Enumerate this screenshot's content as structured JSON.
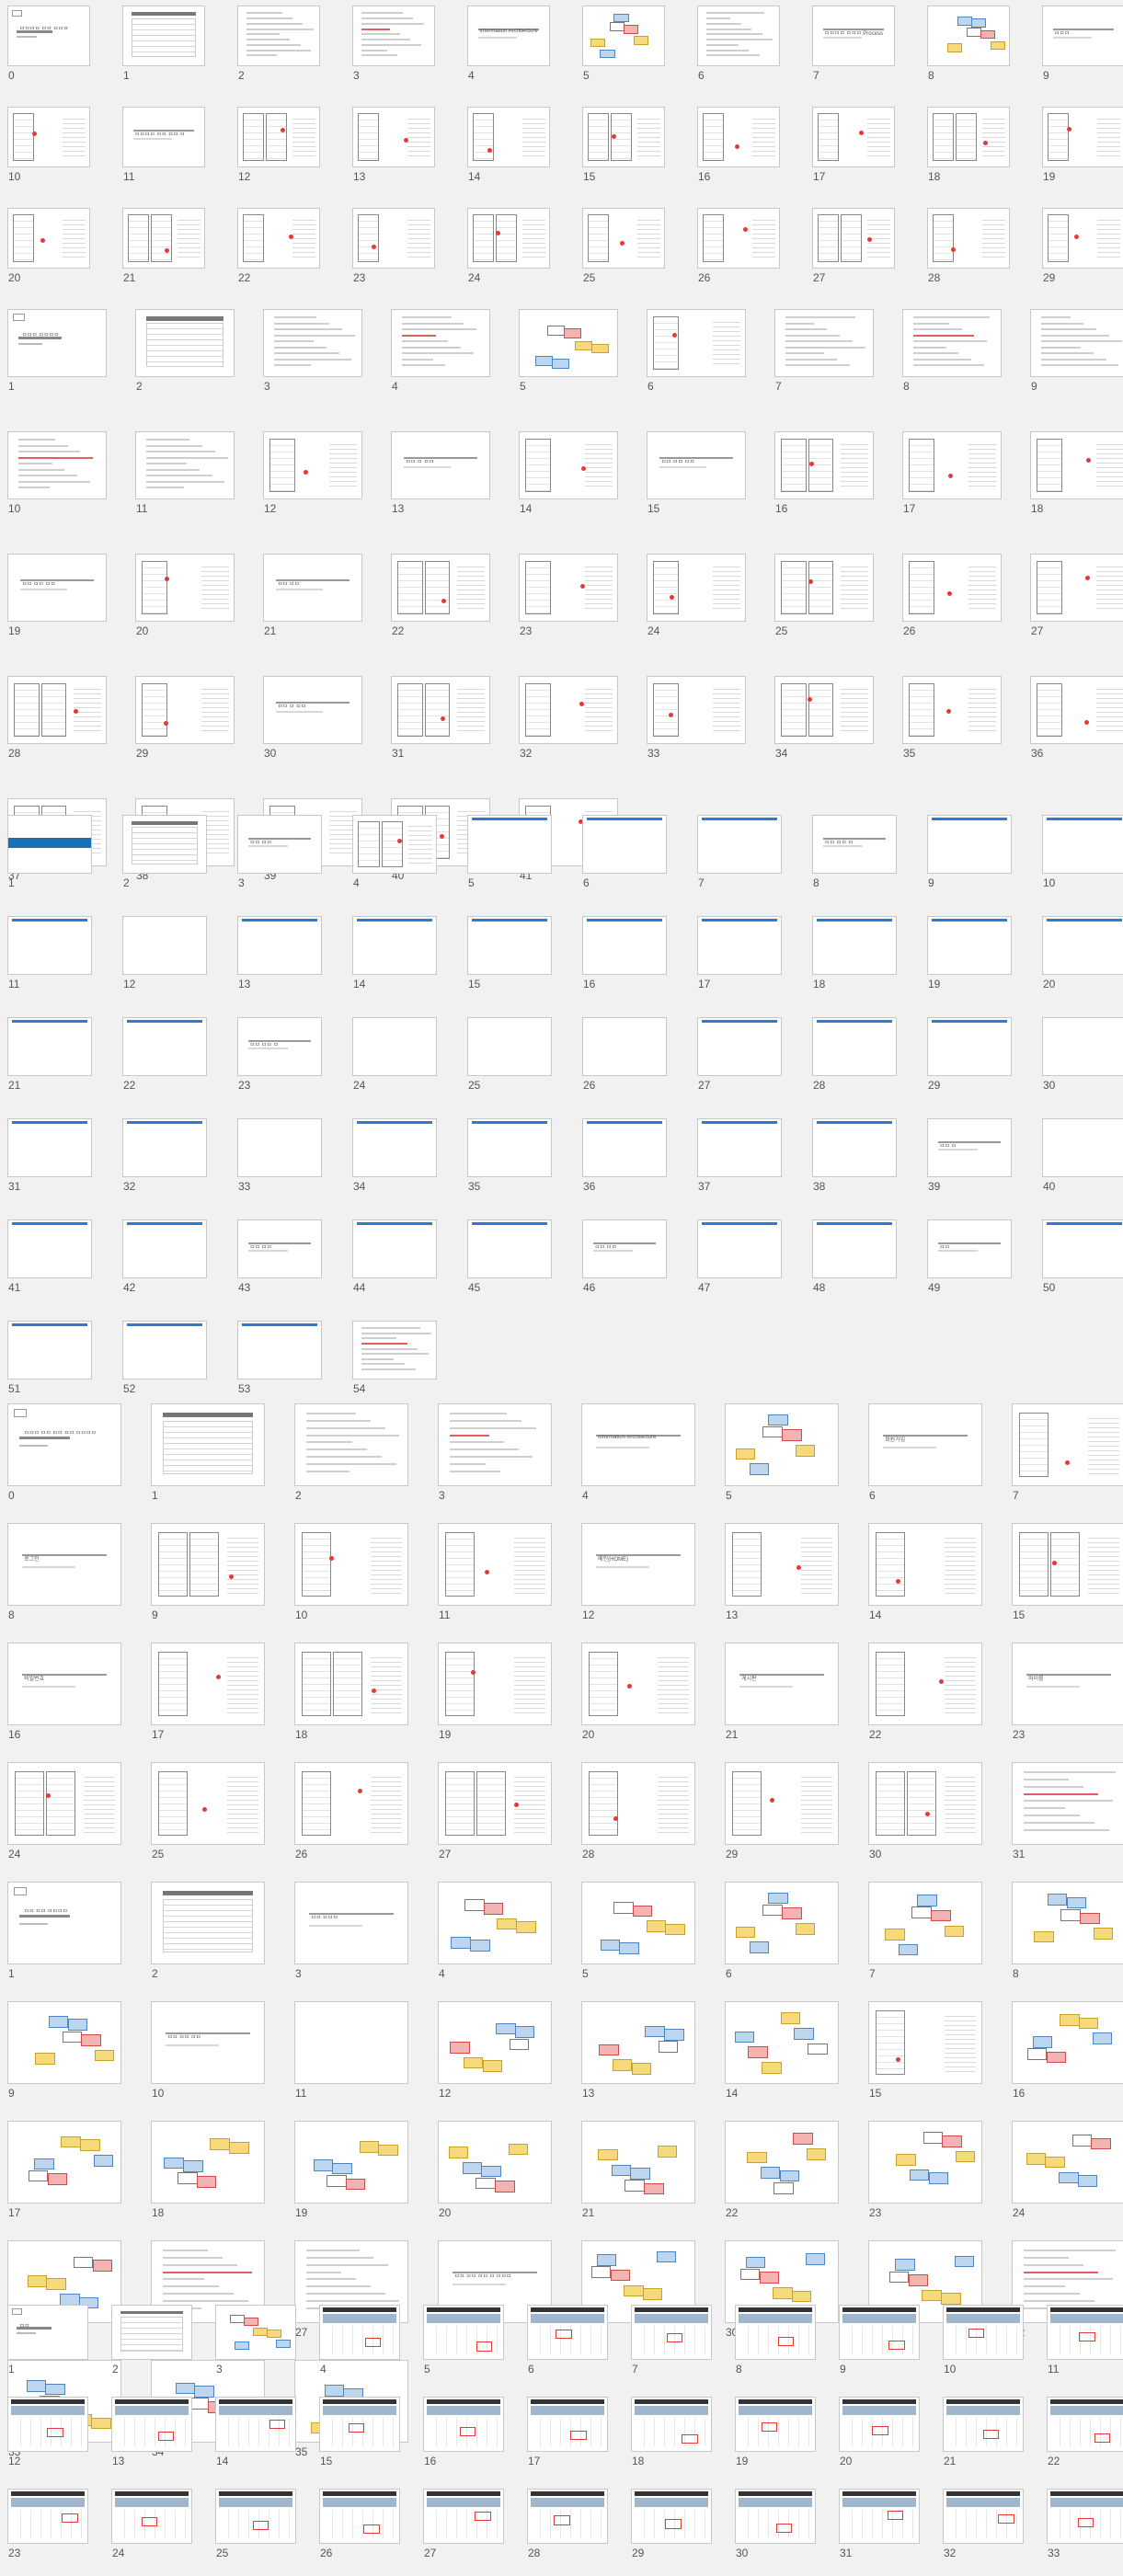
{
  "sections": [
    {
      "id": "deck1",
      "slides": [
        {
          "n": "0",
          "k": "title",
          "label": "ㅁㅁㅁㅁ ㅁㅁ ㅁㅁㅁ"
        },
        {
          "n": "1",
          "k": "table"
        },
        {
          "n": "2",
          "k": "doc"
        },
        {
          "n": "3",
          "k": "doc"
        },
        {
          "n": "4",
          "k": "text",
          "label": "Information Architecture"
        },
        {
          "n": "5",
          "k": "flow"
        },
        {
          "n": "6",
          "k": "doc"
        },
        {
          "n": "7",
          "k": "text",
          "label": "ㅁㅁㅁㅁ ㅁㅁㅁ Process"
        },
        {
          "n": "8",
          "k": "flow"
        },
        {
          "n": "9",
          "k": "text",
          "label": "ㅁㅁㅁ"
        },
        {
          "n": "10",
          "k": "wire"
        },
        {
          "n": "11",
          "k": "text",
          "label": "ㅁㅁㅁㅁ ㅁㅁ ㅁㅁ ㅁ"
        },
        {
          "n": "12",
          "k": "wire"
        },
        {
          "n": "13",
          "k": "wire"
        },
        {
          "n": "14",
          "k": "wire"
        },
        {
          "n": "15",
          "k": "wire"
        },
        {
          "n": "16",
          "k": "wire"
        },
        {
          "n": "17",
          "k": "wire"
        },
        {
          "n": "18",
          "k": "wire"
        },
        {
          "n": "19",
          "k": "wire"
        },
        {
          "n": "20",
          "k": "wire"
        },
        {
          "n": "21",
          "k": "wire"
        },
        {
          "n": "22",
          "k": "wire"
        },
        {
          "n": "23",
          "k": "wire"
        },
        {
          "n": "24",
          "k": "wire"
        },
        {
          "n": "25",
          "k": "wire"
        },
        {
          "n": "26",
          "k": "wire"
        },
        {
          "n": "27",
          "k": "wire"
        },
        {
          "n": "28",
          "k": "wire"
        },
        {
          "n": "29",
          "k": "wire"
        }
      ]
    },
    {
      "id": "deck2",
      "slides": [
        {
          "n": "1",
          "k": "title",
          "label": "ㅁㅁㅁ ㅁㅁㅁㅁ"
        },
        {
          "n": "2",
          "k": "table"
        },
        {
          "n": "3",
          "k": "doc"
        },
        {
          "n": "4",
          "k": "doc"
        },
        {
          "n": "5",
          "k": "flow"
        },
        {
          "n": "6",
          "k": "wire"
        },
        {
          "n": "7",
          "k": "doc"
        },
        {
          "n": "8",
          "k": "doc"
        },
        {
          "n": "9",
          "k": "doc"
        },
        {
          "n": "10",
          "k": "doc"
        },
        {
          "n": "11",
          "k": "doc"
        },
        {
          "n": "12",
          "k": "wire"
        },
        {
          "n": "13",
          "k": "text",
          "label": "ㅁㅁ ㅁ ㅁㅁ"
        },
        {
          "n": "14",
          "k": "wire"
        },
        {
          "n": "15",
          "k": "text",
          "label": "ㅁㅁ ㅁㅁ ㅁㅁ"
        },
        {
          "n": "16",
          "k": "wire"
        },
        {
          "n": "17",
          "k": "wire"
        },
        {
          "n": "18",
          "k": "wire"
        },
        {
          "n": "19",
          "k": "text",
          "label": "ㅁㅁ ㅁㅁ ㅁㅁ"
        },
        {
          "n": "20",
          "k": "wire"
        },
        {
          "n": "21",
          "k": "text",
          "label": "ㅁㅁ ㅁㅁ"
        },
        {
          "n": "22",
          "k": "wire"
        },
        {
          "n": "23",
          "k": "wire"
        },
        {
          "n": "24",
          "k": "wire"
        },
        {
          "n": "25",
          "k": "wire"
        },
        {
          "n": "26",
          "k": "wire"
        },
        {
          "n": "27",
          "k": "wire"
        },
        {
          "n": "28",
          "k": "wire"
        },
        {
          "n": "29",
          "k": "wire"
        },
        {
          "n": "30",
          "k": "text",
          "label": "ㅁㅁ ㅁ ㅁㅁ"
        },
        {
          "n": "31",
          "k": "wire"
        },
        {
          "n": "32",
          "k": "wire"
        },
        {
          "n": "33",
          "k": "wire"
        },
        {
          "n": "34",
          "k": "wire"
        },
        {
          "n": "35",
          "k": "wire"
        },
        {
          "n": "36",
          "k": "wire"
        },
        {
          "n": "37",
          "k": "wire"
        },
        {
          "n": "38",
          "k": "wire"
        },
        {
          "n": "39",
          "k": "wire"
        },
        {
          "n": "40",
          "k": "wire"
        },
        {
          "n": "41",
          "k": "wire"
        }
      ]
    },
    {
      "id": "deck3",
      "slides": [
        {
          "n": "1",
          "k": "cover"
        },
        {
          "n": "2",
          "k": "table"
        },
        {
          "n": "3",
          "k": "text",
          "label": "ㅁㅁ ㅁㅁ"
        },
        {
          "n": "4",
          "k": "wire"
        },
        {
          "n": "5",
          "k": "blue"
        },
        {
          "n": "6",
          "k": "blue"
        },
        {
          "n": "7",
          "k": "blue"
        },
        {
          "n": "8",
          "k": "text",
          "label": "ㅁㅁ ㅁㅁ ㅁ"
        },
        {
          "n": "9",
          "k": "blue"
        },
        {
          "n": "10",
          "k": "blue"
        },
        {
          "n": "11",
          "k": "blue"
        },
        {
          "n": "12",
          "k": "dark"
        },
        {
          "n": "13",
          "k": "blue"
        },
        {
          "n": "14",
          "k": "blue"
        },
        {
          "n": "15",
          "k": "blue"
        },
        {
          "n": "16",
          "k": "blue"
        },
        {
          "n": "17",
          "k": "blue"
        },
        {
          "n": "18",
          "k": "blue"
        },
        {
          "n": "19",
          "k": "blue"
        },
        {
          "n": "20",
          "k": "blue"
        },
        {
          "n": "21",
          "k": "blue"
        },
        {
          "n": "22",
          "k": "blue"
        },
        {
          "n": "23",
          "k": "text",
          "label": "ㅁㅁ ㅁㅁ ㅁ"
        },
        {
          "n": "24",
          "k": "dark"
        },
        {
          "n": "25",
          "k": "dark"
        },
        {
          "n": "26",
          "k": "dark"
        },
        {
          "n": "27",
          "k": "blue"
        },
        {
          "n": "28",
          "k": "blue"
        },
        {
          "n": "29",
          "k": "blue"
        },
        {
          "n": "30",
          "k": "dark"
        },
        {
          "n": "31",
          "k": "blue"
        },
        {
          "n": "32",
          "k": "blue"
        },
        {
          "n": "33",
          "k": "dark"
        },
        {
          "n": "34",
          "k": "blue"
        },
        {
          "n": "35",
          "k": "blue"
        },
        {
          "n": "36",
          "k": "blue"
        },
        {
          "n": "37",
          "k": "blue"
        },
        {
          "n": "38",
          "k": "blue"
        },
        {
          "n": "39",
          "k": "text",
          "label": "ㅁㅁ ㅁ"
        },
        {
          "n": "40",
          "k": "dark"
        },
        {
          "n": "41",
          "k": "blue"
        },
        {
          "n": "42",
          "k": "blue"
        },
        {
          "n": "43",
          "k": "text",
          "label": "ㅁㅁ ㅁㅁ"
        },
        {
          "n": "44",
          "k": "blue"
        },
        {
          "n": "45",
          "k": "blue"
        },
        {
          "n": "46",
          "k": "text",
          "label": "ㅁㅁ ㅁㅁ"
        },
        {
          "n": "47",
          "k": "blue"
        },
        {
          "n": "48",
          "k": "blue"
        },
        {
          "n": "49",
          "k": "text",
          "label": "ㅁㅁ"
        },
        {
          "n": "50",
          "k": "blue"
        },
        {
          "n": "51",
          "k": "blue"
        },
        {
          "n": "52",
          "k": "blue"
        },
        {
          "n": "53",
          "k": "blue"
        },
        {
          "n": "54",
          "k": "doc"
        }
      ]
    },
    {
      "id": "deck4",
      "slides": [
        {
          "n": "0",
          "k": "title",
          "label": "ㅁㅁㅁ ㅁㅁ ㅁㅁ ㅁㅁ ㅁㅁㅁㅁ"
        },
        {
          "n": "1",
          "k": "table"
        },
        {
          "n": "2",
          "k": "doc"
        },
        {
          "n": "3",
          "k": "doc"
        },
        {
          "n": "4",
          "k": "text",
          "label": "Information Architecture"
        },
        {
          "n": "5",
          "k": "flow"
        },
        {
          "n": "6",
          "k": "text",
          "label": "회원가입"
        },
        {
          "n": "7",
          "k": "wire"
        },
        {
          "n": "8",
          "k": "text",
          "label": "로그인"
        },
        {
          "n": "9",
          "k": "wire"
        },
        {
          "n": "10",
          "k": "wire"
        },
        {
          "n": "11",
          "k": "wire"
        },
        {
          "n": "12",
          "k": "text",
          "label": "메인(HOME)"
        },
        {
          "n": "13",
          "k": "wire"
        },
        {
          "n": "14",
          "k": "wire"
        },
        {
          "n": "15",
          "k": "wire"
        },
        {
          "n": "16",
          "k": "text",
          "label": "비밀번호"
        },
        {
          "n": "17",
          "k": "wire"
        },
        {
          "n": "18",
          "k": "wire"
        },
        {
          "n": "19",
          "k": "wire"
        },
        {
          "n": "20",
          "k": "wire"
        },
        {
          "n": "21",
          "k": "text",
          "label": "게시판"
        },
        {
          "n": "22",
          "k": "wire"
        },
        {
          "n": "23",
          "k": "text",
          "label": "마이룸"
        },
        {
          "n": "24",
          "k": "wire"
        },
        {
          "n": "25",
          "k": "wire"
        },
        {
          "n": "26",
          "k": "wire"
        },
        {
          "n": "27",
          "k": "wire"
        },
        {
          "n": "28",
          "k": "wire"
        },
        {
          "n": "29",
          "k": "wire"
        },
        {
          "n": "30",
          "k": "wire"
        },
        {
          "n": "31",
          "k": "doc"
        }
      ]
    },
    {
      "id": "deck5",
      "slides": [
        {
          "n": "1",
          "k": "title",
          "label": "ㅁㅁ ㅁㅁ ㅁㅁㅁㅁ"
        },
        {
          "n": "2",
          "k": "table"
        },
        {
          "n": "3",
          "k": "text",
          "label": "ㅁㅁ ㅁㅁㅁ"
        },
        {
          "n": "4",
          "k": "flow"
        },
        {
          "n": "5",
          "k": "flow"
        },
        {
          "n": "6",
          "k": "flow"
        },
        {
          "n": "7",
          "k": "flow"
        },
        {
          "n": "8",
          "k": "flow"
        },
        {
          "n": "9",
          "k": "flow"
        },
        {
          "n": "10",
          "k": "text",
          "label": "ㅁㅁ ㅁㅁ ㅁㅁ"
        },
        {
          "n": "11",
          "k": "dark"
        },
        {
          "n": "12",
          "k": "flow"
        },
        {
          "n": "13",
          "k": "flow"
        },
        {
          "n": "14",
          "k": "flow"
        },
        {
          "n": "15",
          "k": "wire"
        },
        {
          "n": "16",
          "k": "flow"
        },
        {
          "n": "17",
          "k": "flow"
        },
        {
          "n": "18",
          "k": "flow"
        },
        {
          "n": "19",
          "k": "flow"
        },
        {
          "n": "20",
          "k": "flow"
        },
        {
          "n": "21",
          "k": "flow"
        },
        {
          "n": "22",
          "k": "flow"
        },
        {
          "n": "23",
          "k": "flow"
        },
        {
          "n": "24",
          "k": "flow"
        },
        {
          "n": "25",
          "k": "flow"
        },
        {
          "n": "26",
          "k": "doc"
        },
        {
          "n": "27",
          "k": "doc"
        },
        {
          "n": "28",
          "k": "text",
          "label": "ㅁㅁ ㅁㅁ ㅁㅁ ㅁ ㅁㅁㅁ"
        },
        {
          "n": "29",
          "k": "flow"
        },
        {
          "n": "30",
          "k": "flow"
        },
        {
          "n": "31",
          "k": "flow"
        },
        {
          "n": "32",
          "k": "doc"
        },
        {
          "n": "33",
          "k": "flow"
        },
        {
          "n": "34",
          "k": "flow"
        },
        {
          "n": "35",
          "k": "flow"
        }
      ]
    },
    {
      "id": "deck6",
      "slides": [
        {
          "n": "1",
          "k": "title",
          "label": "ㅁㅁ"
        },
        {
          "n": "2",
          "k": "table"
        },
        {
          "n": "3",
          "k": "flow"
        },
        {
          "n": "4",
          "k": "web"
        },
        {
          "n": "5",
          "k": "web"
        },
        {
          "n": "6",
          "k": "web"
        },
        {
          "n": "7",
          "k": "web"
        },
        {
          "n": "8",
          "k": "web"
        },
        {
          "n": "9",
          "k": "web"
        },
        {
          "n": "10",
          "k": "web"
        },
        {
          "n": "11",
          "k": "web"
        },
        {
          "n": "12",
          "k": "web"
        },
        {
          "n": "13",
          "k": "web"
        },
        {
          "n": "14",
          "k": "web"
        },
        {
          "n": "15",
          "k": "web"
        },
        {
          "n": "16",
          "k": "web"
        },
        {
          "n": "17",
          "k": "web"
        },
        {
          "n": "18",
          "k": "web"
        },
        {
          "n": "19",
          "k": "web"
        },
        {
          "n": "20",
          "k": "web"
        },
        {
          "n": "21",
          "k": "web"
        },
        {
          "n": "22",
          "k": "web"
        },
        {
          "n": "23",
          "k": "web"
        },
        {
          "n": "24",
          "k": "web"
        },
        {
          "n": "25",
          "k": "web"
        },
        {
          "n": "26",
          "k": "web"
        },
        {
          "n": "27",
          "k": "web"
        },
        {
          "n": "28",
          "k": "web"
        },
        {
          "n": "29",
          "k": "web"
        },
        {
          "n": "30",
          "k": "web"
        },
        {
          "n": "31",
          "k": "web"
        },
        {
          "n": "32",
          "k": "web"
        },
        {
          "n": "33",
          "k": "web"
        }
      ]
    }
  ]
}
